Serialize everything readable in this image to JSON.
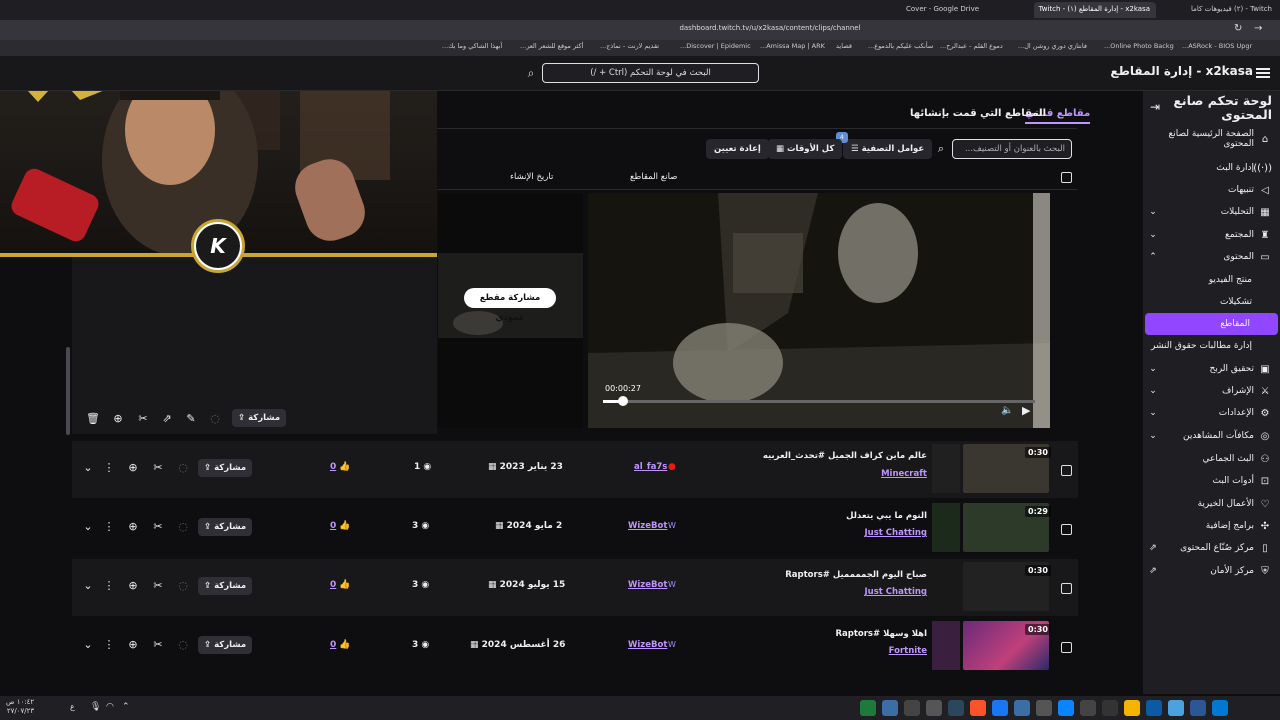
{
  "browser": {
    "tabs": [
      "Twitch - (٢) فيديوهات كاما",
      "x2kasa - إدارة المقاطع (١) - Twitch",
      "Cover - Google Drive"
    ],
    "url": "dashboard.twitch.tv/u/x2kasa/content/clips/channel",
    "bookmarks": [
      "ASRock - BIOS Upgr...",
      "Online Photo Backg...",
      "فانتازي دوري روشن ال...",
      "دموع القلم - عبدالرح...",
      "سأنكب عليكم بالدموع...",
      "قصايد",
      "Amissa Map | ARK...",
      "Discover | Epidemic...",
      "تقديم لارنت - نماذج...",
      "أكثر موقع للشعر العر...",
      "أبهذا الشاكي وما بك..."
    ]
  },
  "header": {
    "brand": "x2kasa - إدارة المقاطع",
    "search_placeholder": "البحث في لوحة التحكم (Ctrl + /)"
  },
  "sidebar": {
    "title": "لوحة تحكم صانع المحتوى",
    "items": [
      {
        "label": "الصفحة الرئيسية لصانع المحتوى",
        "icon": "home-icon"
      },
      {
        "label": "إدارة البث",
        "icon": "broadcast-icon"
      },
      {
        "label": "تنبيهات",
        "icon": "megaphone-icon"
      },
      {
        "label": "التحليلات",
        "icon": "analytics-icon",
        "chevron": "⌄"
      },
      {
        "label": "المجتمع",
        "icon": "community-icon",
        "chevron": "⌄"
      },
      {
        "label": "المحتوى",
        "icon": "content-icon",
        "chevron": "⌃"
      },
      {
        "label": "منتج الفيديو",
        "sub": true
      },
      {
        "label": "تشكيلات",
        "sub": true
      },
      {
        "label": "المقاطع",
        "sub": true,
        "active": true
      },
      {
        "label": "إدارة مطالبات حقوق النشر",
        "sub": true
      },
      {
        "label": "تحقيق الربح",
        "icon": "money-icon",
        "chevron": "⌄"
      },
      {
        "label": "الإشراف",
        "icon": "sword-icon",
        "chevron": "⌄"
      },
      {
        "label": "الإعدادات",
        "icon": "gear-icon",
        "chevron": "⌄"
      },
      {
        "label": "مكافآت المشاهدين",
        "icon": "reward-icon",
        "chevron": "⌄"
      },
      {
        "label": "البث الجماعي",
        "icon": "group-icon"
      },
      {
        "label": "أدوات البث",
        "icon": "tools-icon"
      },
      {
        "label": "الأعمال الخيرية",
        "icon": "heart-icon"
      },
      {
        "label": "برامج إضافية",
        "icon": "puzzle-icon"
      },
      {
        "label": "مركز صُنّاع المحتوى",
        "icon": "book-icon",
        "ext": true
      },
      {
        "label": "مركز الأمان",
        "icon": "shield-icon",
        "ext": true
      }
    ]
  },
  "main": {
    "tabs": [
      "مقاطع قناتي",
      "المقاطع التي قمت بإنشائها"
    ],
    "filter_placeholder": "البحث بالعنوان أو التصنيف...",
    "filters_label": "عوامل التصفية",
    "filters_badge": "4",
    "time_label": "كل الأوقات",
    "reset_label": "إعادة تعيين",
    "col_creator": "صانع المقاطع",
    "col_date": "تاريخ الإنشاء",
    "preview_time": "00:00:27",
    "vertical_share": "مشاركة مقطع عمودي",
    "share_label": "مشاركة",
    "rows": [
      {
        "duration": "0:30",
        "title": "عالم ماين كراف الجميل #تحدث_العربيه",
        "game": "Minecraft",
        "creator": "al_fa7s",
        "date": "23 يناير 2023",
        "views": "1",
        "likes": "0"
      },
      {
        "duration": "0:29",
        "title": "النوم ما يبي يتعدلل",
        "game": "Just Chatting",
        "creator": "WizeBot",
        "date": "2 مايو 2024",
        "views": "3",
        "likes": "0"
      },
      {
        "duration": "0:30",
        "title": "صباح اليوم الجمممميل #Raptors",
        "game": "Just Chatting",
        "creator": "WizeBot",
        "date": "15 يوليو 2024",
        "views": "3",
        "likes": "0"
      },
      {
        "duration": "0:30",
        "title": "اهلا وسهلا #Raptors",
        "game": "Fortnite",
        "creator": "WizeBot",
        "date": "26 أغسطس 2024",
        "views": "3",
        "likes": "0"
      }
    ]
  },
  "webcam": {
    "logo_letter": "K"
  },
  "taskbar": {
    "time": "١٠:٤٢ ص",
    "date": "٢٧/٠٧/٢٣"
  }
}
